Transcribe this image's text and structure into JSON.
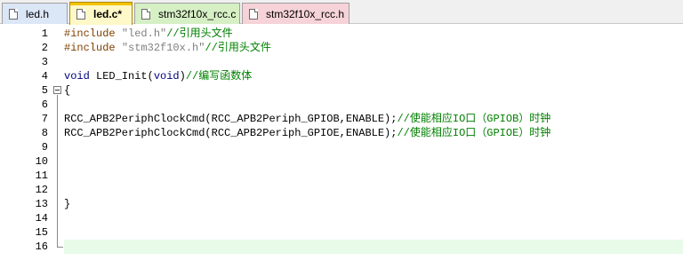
{
  "tabs": [
    {
      "label": "led.h",
      "color": "#dbe6f7"
    },
    {
      "label": "led.c*",
      "color": "#fff8c8"
    },
    {
      "label": "stm32f10x_rcc.c",
      "color": "#d6efc4"
    },
    {
      "label": "stm32f10x_rcc.h",
      "color": "#f6d3d8"
    }
  ],
  "lines": [
    {
      "num": "1",
      "parts": [
        [
          "pp",
          "#include "
        ],
        [
          "str",
          "\"led.h\""
        ],
        [
          "cmt",
          "//引用头文件"
        ]
      ]
    },
    {
      "num": "2",
      "parts": [
        [
          "pp",
          "#include "
        ],
        [
          "str",
          "\"stm32f10x.h\""
        ],
        [
          "cmt",
          "//引用头文件"
        ]
      ]
    },
    {
      "num": "3",
      "parts": []
    },
    {
      "num": "4",
      "parts": [
        [
          "kw",
          "void"
        ],
        [
          "",
          " LED_Init("
        ],
        [
          "kw",
          "void"
        ],
        [
          "",
          ")"
        ],
        [
          "cmt",
          "//编写函数体"
        ]
      ]
    },
    {
      "num": "5",
      "parts": [
        [
          "",
          "{"
        ]
      ]
    },
    {
      "num": "6",
      "parts": []
    },
    {
      "num": "7",
      "parts": [
        [
          "",
          "RCC_APB2PeriphClockCmd(RCC_APB2Periph_GPIOB,ENABLE);"
        ],
        [
          "cmt",
          "//使能相应IO口（GPIOB）时钟"
        ]
      ]
    },
    {
      "num": "8",
      "parts": [
        [
          "",
          "RCC_APB2PeriphClockCmd(RCC_APB2Periph_GPIOE,ENABLE);"
        ],
        [
          "cmt",
          "//使能相应IO口（GPIOE）时钟"
        ]
      ]
    },
    {
      "num": "9",
      "parts": []
    },
    {
      "num": "10",
      "parts": []
    },
    {
      "num": "11",
      "parts": []
    },
    {
      "num": "12",
      "parts": []
    },
    {
      "num": "13",
      "parts": [
        [
          "",
          "}"
        ]
      ]
    },
    {
      "num": "14",
      "parts": []
    },
    {
      "num": "15",
      "parts": []
    },
    {
      "num": "16",
      "parts": []
    }
  ],
  "current_line": "16"
}
